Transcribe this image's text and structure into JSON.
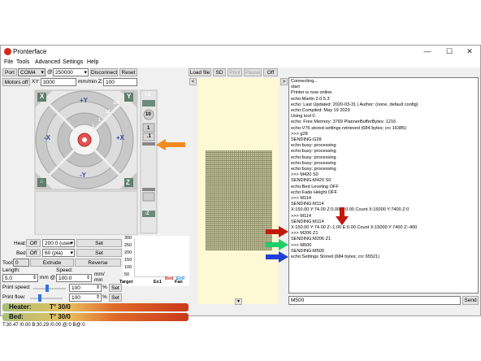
{
  "window": {
    "title": "Pronterface"
  },
  "window_controls": {
    "minimize": "—",
    "maximize": "☐",
    "close": "✕"
  },
  "menu": [
    "File",
    "Tools",
    "Advanced",
    "Settings",
    "Help"
  ],
  "connection": {
    "port_label": "Port",
    "port_value": "COM4",
    "at": "@",
    "baud_value": "250000",
    "disconnect": "Disconnect",
    "reset": "Reset"
  },
  "motors": {
    "motors_off": "Motors off",
    "xy_label": "XY:",
    "xy_value": "3000",
    "rate_label": "mm/min Z:",
    "z_value": "100"
  },
  "jog": {
    "home_x": "X",
    "home_y": "Y",
    "home_z": "Z",
    "y_plus": "+Y",
    "y_minus": "-Y",
    "x_plus": "+X",
    "x_minus": "-X",
    "ring_100": "100",
    "ring_10": "10",
    "ring_1": "1",
    "ring_01": ".1",
    "z_plus": "+Z",
    "z_minus": "-Z",
    "z_10": "10",
    "z_1": "1",
    "z_01": ".1"
  },
  "temps": {
    "heat_label": "Heat:",
    "heat_off": "Off",
    "heat_value": "200.0 (user",
    "set": "Set",
    "bed_label": "Bed:",
    "bed_off": "Off",
    "bed_value": "60 (pla)",
    "graph_ticks": [
      "300",
      "250",
      "200",
      "150",
      "100",
      "50"
    ],
    "graph_legend": [
      "Target",
      "Ex1",
      "Bed",
      "Ex0",
      "Fan"
    ]
  },
  "tool": {
    "tool_label": "Tool:",
    "tool_value": "0",
    "extrude": "Extrude",
    "reverse": "Reverse",
    "length_label": "Length:",
    "length_value": "5.0",
    "mm_at": "mm @",
    "speed_label": "Speed:",
    "speed_value": "100.0",
    "mm_min": "mm/ min"
  },
  "print": {
    "speed_label": "Print speed:",
    "speed_value": "100",
    "flow_label": "Print flow:",
    "flow_value": "100",
    "percent": "%",
    "set": "Set"
  },
  "status_bars": {
    "heater": "Heater:",
    "heater_temp": "T° 30/0",
    "bed": "Bed:",
    "bed_temp": "T° 30/0"
  },
  "status_text": "T:30.47 /0.00 B:30.29 /0.00 @:0 B@:0",
  "file_toolbar": {
    "load_file": "Load file",
    "sd": "SD",
    "print": "Print",
    "pause": "Pause",
    "off": "Off",
    "nav_left": "<",
    "nav_right": ">",
    "scroll_down": "▾"
  },
  "log_lines": [
    "Connecting...",
    "start",
    "Printer is now online.",
    "echo:Marlin 2.0.5.3",
    "echo: Last Updated: 2020-03-31 | Author: (none, default config)",
    "echo:Compiled: May 19 2020",
    "Using tool 0.",
    "echo: Free Memory: 3769  PlannerBufferBytes: 1216",
    "echo:V76 stored settings retrieved (684 bytes; crc 16385)",
    ">>> g28",
    "SENDING:G28",
    "echo:busy: processing",
    "echo:busy: processing",
    "echo:busy: processing",
    "echo:busy: processing",
    "echo:busy: processing",
    ">>> M420 S0",
    "SENDING:M420 S0",
    "echo:Bed Leveling OFF",
    "echo:Fade Height OFF",
    ">>> M114",
    "SENDING:M114",
    "X:150.00 Y:74.00 Z:0.00 E:0.00 Count X:15000 Y:7400 Z:0",
    ">>> M114",
    "SENDING:M114",
    "X:150.00 Y:74.00 Z:-1.00 E:0.00 Count X:15000 Y:7400 Z:-400",
    ">>> M206 Z1",
    "SENDING:M206 Z1",
    ">>> M500",
    "SENDING:M500",
    "echo:Settings Stored (684 bytes; crc 65521)"
  ],
  "command": {
    "value": "M500",
    "send": "Send"
  },
  "annotation_colors": {
    "orange": "#f28a1e",
    "red": "#c0180c",
    "green": "#1fcf6a",
    "blue": "#1f3fd8"
  }
}
